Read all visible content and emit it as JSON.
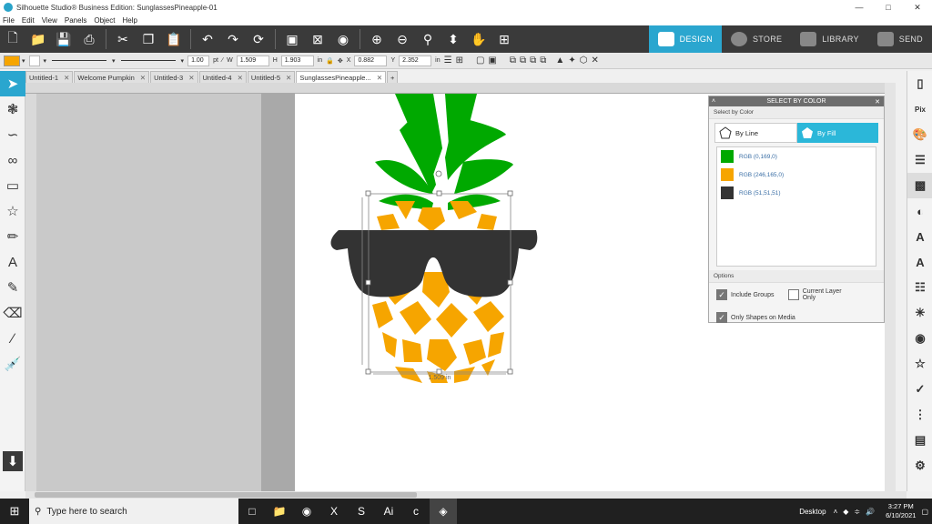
{
  "window": {
    "title": "Silhouette Studio® Business Edition: SunglassesPineapple-01"
  },
  "menu": [
    "File",
    "Edit",
    "View",
    "Panels",
    "Object",
    "Help"
  ],
  "navtabs": [
    "DESIGN",
    "STORE",
    "LIBRARY",
    "SEND"
  ],
  "props": {
    "line_width": "1.00",
    "line_unit": "pt",
    "w_label": "W",
    "w": "1.509",
    "h_label": "H",
    "h": "1.903",
    "unit": "in",
    "x_label": "X",
    "x": "0.882",
    "y_label": "Y",
    "y": "2.352",
    "unit2": "in"
  },
  "tabs": [
    "Untitled-1",
    "Welcome Pumpkin",
    "Untitled-3",
    "Untitled-4",
    "Untitled-5",
    "SunglassesPineapple..."
  ],
  "tab_add": "+",
  "dimension": "1.509 in",
  "panel": {
    "title": "SELECT BY COLOR",
    "section": "Select by Color",
    "by_line": "By Line",
    "by_fill": "By Fill",
    "colors": [
      {
        "label": "RGB (0,169,0)",
        "hex": "#00a900"
      },
      {
        "label": "RGB (246,165,0)",
        "hex": "#f6a500"
      },
      {
        "label": "RGB (51,51,51)",
        "hex": "#333333"
      }
    ],
    "options_label": "Options",
    "include_groups": "Include Groups",
    "current_layer_only": "Current Layer Only",
    "only_shapes": "Only Shapes on Media"
  },
  "taskbar": {
    "search_placeholder": "Type here to search",
    "desktop": "Desktop",
    "time": "3:27 PM",
    "date": "6/10/2021"
  },
  "accent": "#2aa6cf"
}
